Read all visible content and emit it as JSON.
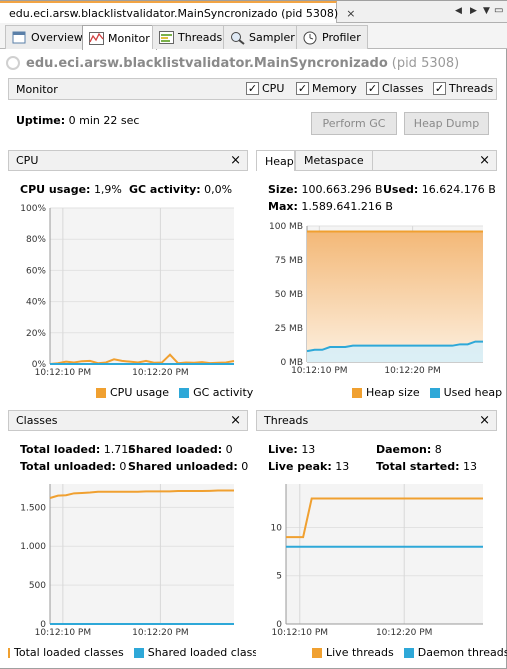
{
  "window": {
    "tab_title": "edu.eci.arsw.blacklistvalidator.MainSyncronizado (pid 5308)",
    "close_glyph": "×"
  },
  "subtabs": [
    {
      "label": "Overview",
      "icon": "overview-icon"
    },
    {
      "label": "Monitor",
      "icon": "monitor-icon"
    },
    {
      "label": "Threads",
      "icon": "threads-icon"
    },
    {
      "label": "Sampler",
      "icon": "sampler-icon"
    },
    {
      "label": "Profiler",
      "icon": "profiler-icon"
    }
  ],
  "header": {
    "app_name": "edu.eci.arsw.blacklistvalidator.MainSyncronizado",
    "pid": "(pid 5308)"
  },
  "monitor_bar": {
    "title": "Monitor",
    "checkboxes": [
      {
        "label": "CPU",
        "checked": true
      },
      {
        "label": "Memory",
        "checked": true
      },
      {
        "label": "Classes",
        "checked": true
      },
      {
        "label": "Threads",
        "checked": true
      }
    ]
  },
  "uptime": {
    "label": "Uptime:",
    "value": "0 min 22 sec"
  },
  "buttons": {
    "gc": "Perform GC",
    "heap_dump": "Heap Dump"
  },
  "colors": {
    "orange": "#f0a030",
    "blue": "#2ea8d8",
    "plot_bg": "#f4f4f4",
    "grid": "#d8d8d8"
  },
  "cpu_panel": {
    "title": "CPU",
    "cpu_usage_label": "CPU usage:",
    "cpu_usage_value": "1,9%",
    "gc_label": "GC activity:",
    "gc_value": "0,0%",
    "legend": [
      "CPU usage",
      "GC activity"
    ]
  },
  "memory_panel": {
    "tabs": [
      "Heap",
      "Metaspace"
    ],
    "size_label": "Size:",
    "size_value": "100.663.296 B",
    "used_label": "Used:",
    "used_value": "16.624.176 B",
    "max_label": "Max:",
    "max_value": "1.589.641.216 B",
    "legend": [
      "Heap size",
      "Used heap"
    ]
  },
  "classes_panel": {
    "title": "Classes",
    "total_loaded_label": "Total loaded:",
    "total_loaded_value": "1.716",
    "shared_loaded_label": "Shared loaded:",
    "shared_loaded_value": "0",
    "total_unloaded_label": "Total unloaded:",
    "total_unloaded_value": "0",
    "shared_unloaded_label": "Shared unloaded:",
    "shared_unloaded_value": "0",
    "legend": [
      "Total loaded classes",
      "Shared loaded classes"
    ]
  },
  "threads_panel": {
    "title": "Threads",
    "live_label": "Live:",
    "live_value": "13",
    "daemon_label": "Daemon:",
    "daemon_value": "8",
    "peak_label": "Live peak:",
    "peak_value": "13",
    "started_label": "Total started:",
    "started_value": "13",
    "legend": [
      "Live threads",
      "Daemon threads"
    ]
  },
  "chart_data": [
    {
      "type": "line",
      "name": "cpu",
      "x_ticks": [
        "10:12:10 PM",
        "10:12:20 PM"
      ],
      "y_ticks": [
        "100%",
        "80%",
        "60%",
        "40%",
        "20%",
        "0%"
      ],
      "ylim": [
        0,
        100
      ],
      "x": [
        0,
        1,
        2,
        3,
        4,
        5,
        6,
        7,
        8,
        9,
        10,
        11,
        12,
        13,
        14,
        15,
        16,
        17,
        18,
        19,
        20,
        21,
        22,
        23
      ],
      "series": [
        {
          "name": "CPU usage",
          "color": "#f0a030",
          "values": [
            0,
            0.5,
            1.5,
            1,
            1.8,
            2,
            0.5,
            1,
            3,
            2,
            1.5,
            1,
            2,
            0.8,
            1,
            6,
            0.5,
            1,
            0.8,
            1.2,
            0.6,
            0.8,
            1,
            1.9
          ]
        },
        {
          "name": "GC activity",
          "color": "#2ea8d8",
          "values": [
            0,
            0,
            0,
            0,
            0,
            0,
            0,
            0,
            0,
            0,
            0,
            0,
            0,
            0,
            0,
            0,
            0,
            0,
            0,
            0,
            0,
            0,
            0,
            0
          ]
        }
      ]
    },
    {
      "type": "area",
      "name": "heap",
      "x_ticks": [
        "10:12:10 PM",
        "10:12:20 PM"
      ],
      "y_ticks": [
        "100 MB",
        "75 MB",
        "50 MB",
        "25 MB",
        "0 MB"
      ],
      "ylim": [
        0,
        100
      ],
      "x": [
        0,
        1,
        2,
        3,
        4,
        5,
        6,
        7,
        8,
        9,
        10,
        11,
        12,
        13,
        14,
        15,
        16,
        17,
        18,
        19,
        20,
        21,
        22,
        23
      ],
      "series": [
        {
          "name": "Heap size",
          "color": "#f0a030",
          "values": [
            96,
            96,
            96,
            96,
            96,
            96,
            96,
            96,
            96,
            96,
            96,
            96,
            96,
            96,
            96,
            96,
            96,
            96,
            96,
            96,
            96,
            96,
            96,
            96
          ]
        },
        {
          "name": "Used heap",
          "color": "#2ea8d8",
          "values": [
            8,
            9,
            9,
            11,
            11,
            11,
            12,
            12,
            12,
            12,
            12,
            12,
            12,
            12,
            12,
            12,
            12,
            12,
            12,
            12,
            13,
            13,
            15,
            15
          ]
        }
      ]
    },
    {
      "type": "line",
      "name": "classes",
      "x_ticks": [
        "10:12:10 PM",
        "10:12:20 PM"
      ],
      "y_ticks": [
        "1.500",
        "1.000",
        "500",
        "0"
      ],
      "ylim": [
        0,
        1800
      ],
      "x": [
        0,
        1,
        2,
        3,
        4,
        5,
        6,
        7,
        8,
        9,
        10,
        11,
        12,
        13,
        14,
        15,
        16,
        17,
        18,
        19,
        20,
        21,
        22,
        23
      ],
      "series": [
        {
          "name": "Total loaded classes",
          "color": "#f0a030",
          "values": [
            1620,
            1650,
            1655,
            1680,
            1685,
            1690,
            1700,
            1700,
            1700,
            1700,
            1700,
            1700,
            1705,
            1705,
            1705,
            1705,
            1710,
            1710,
            1710,
            1710,
            1712,
            1716,
            1716,
            1716
          ]
        },
        {
          "name": "Shared loaded classes",
          "color": "#2ea8d8",
          "values": [
            0,
            0,
            0,
            0,
            0,
            0,
            0,
            0,
            0,
            0,
            0,
            0,
            0,
            0,
            0,
            0,
            0,
            0,
            0,
            0,
            0,
            0,
            0,
            0
          ]
        }
      ]
    },
    {
      "type": "line",
      "name": "threads",
      "x_ticks": [
        "10:12:10 PM",
        "10:12:20 PM"
      ],
      "y_ticks": [
        "10",
        "5",
        "0"
      ],
      "ylim": [
        0,
        14.5
      ],
      "x": [
        0,
        1,
        2,
        3,
        4,
        5,
        6,
        7,
        8,
        9,
        10,
        11,
        12,
        13,
        14,
        15,
        16,
        17,
        18,
        19,
        20,
        21,
        22,
        23
      ],
      "series": [
        {
          "name": "Live threads",
          "color": "#f0a030",
          "values": [
            9,
            9,
            9,
            13,
            13,
            13,
            13,
            13,
            13,
            13,
            13,
            13,
            13,
            13,
            13,
            13,
            13,
            13,
            13,
            13,
            13,
            13,
            13,
            13
          ]
        },
        {
          "name": "Daemon threads",
          "color": "#2ea8d8",
          "values": [
            8,
            8,
            8,
            8,
            8,
            8,
            8,
            8,
            8,
            8,
            8,
            8,
            8,
            8,
            8,
            8,
            8,
            8,
            8,
            8,
            8,
            8,
            8,
            8
          ]
        }
      ]
    }
  ]
}
